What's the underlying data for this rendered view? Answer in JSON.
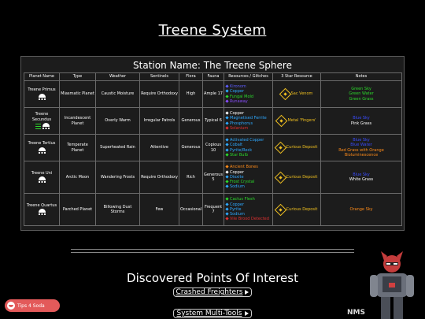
{
  "system_title": "Treene System",
  "station_title": "Station Name: The Treene Sphere",
  "columns": [
    "Planet Name",
    "Type",
    "Weather",
    "Sentinels",
    "Flora",
    "Fauna",
    "Resources / Glitches",
    "3 Star Resource",
    "Notes"
  ],
  "rows": [
    {
      "name": "Treene Primus",
      "type": "Miasmatic Planet",
      "weather": "Caustic Moisture",
      "sentinels": "Require Orthodoxy",
      "flora": "High",
      "fauna": "Ample 17",
      "resources": [
        {
          "t": "Kironom",
          "c": "#5e5eff"
        },
        {
          "t": "Copper",
          "c": "#2ea9ff"
        },
        {
          "t": "Fungal Mold",
          "c": "#2bd92b"
        },
        {
          "t": "Runaway",
          "c": "#8a4dff"
        }
      ],
      "star": "Sac Venom",
      "star_color": "#f0c020",
      "notes": [
        {
          "t": "Green Sky",
          "c": "#2bd92b"
        },
        {
          "t": "Green Water",
          "c": "#2bd92b"
        },
        {
          "t": "Green Grass",
          "c": "#2bd92b"
        }
      ]
    },
    {
      "name": "Treene Secundus",
      "type": "Incandescent Planet",
      "weather": "Overly Warm",
      "sentinels": "Irregular Patrols",
      "flora": "Generous",
      "fauna": "Typical 6",
      "resources": [
        {
          "t": "Copper",
          "c": "#ffffff"
        },
        {
          "t": "Magnetised Ferrite",
          "c": "#2ea9ff"
        },
        {
          "t": "Phosphorus",
          "c": "#2ea9ff"
        },
        {
          "t": "Solanium",
          "c": "#e03030"
        }
      ],
      "star": "Metal 'Fingers'",
      "star_color": "#f0c020",
      "notes": [
        {
          "t": "Blue Sky",
          "c": "#3a4cff"
        },
        {
          "t": "Pink Grass",
          "c": "#ffffff"
        }
      ]
    },
    {
      "name": "Treene Tertius",
      "type": "Temperate Planet",
      "weather": "Superheated Rain",
      "sentinels": "Attentive",
      "flora": "Generous",
      "fauna": "Copious 10",
      "resources": [
        {
          "t": "Activated Copper",
          "c": "#2ea9ff"
        },
        {
          "t": "Cobalt",
          "c": "#2ea9ff"
        },
        {
          "t": "Pyrite/Rock",
          "c": "#2ea9ff"
        },
        {
          "t": "Star Bulb",
          "c": "#2bd92b"
        }
      ],
      "star": "Curious Deposit",
      "star_color": "#f0c020",
      "notes": [
        {
          "t": "Blue Sky",
          "c": "#3a4cff"
        },
        {
          "t": "Blue Water",
          "c": "#3a4cff"
        },
        {
          "t": "Red Grass with Orange Bioluminescence",
          "c": "#ff8c1a"
        }
      ]
    },
    {
      "name": "Treene Uni",
      "type": "Arctic Moon",
      "weather": "Wandering Frosts",
      "sentinels": "Require Orthodoxy",
      "flora": "Rich",
      "fauna": "Generous 5",
      "resources": [
        {
          "t": "Ancient Bones",
          "c": "#ff8c1a"
        },
        {
          "t": "Copper",
          "c": "#ffffff"
        },
        {
          "t": "Dioxite",
          "c": "#2ea9ff"
        },
        {
          "t": "Frost Crystal",
          "c": "#2bd92b"
        },
        {
          "t": "Sodium",
          "c": "#2ea9ff"
        }
      ],
      "star": "Curious Deposit",
      "star_color": "#f0c020",
      "notes": [
        {
          "t": "Blue Sky",
          "c": "#3a4cff"
        },
        {
          "t": "White Grass",
          "c": "#ffffff"
        }
      ]
    },
    {
      "name": "Treene Quartus",
      "type": "Parched Planet",
      "weather": "Billowing Dust Storms",
      "sentinels": "Few",
      "flora": "Occasional",
      "fauna": "Frequent 7",
      "resources": [
        {
          "t": "Cactus Flesh",
          "c": "#2bd92b"
        },
        {
          "t": "Copper",
          "c": "#2ea9ff"
        },
        {
          "t": "Pyrite",
          "c": "#2ea9ff"
        },
        {
          "t": "Sodium",
          "c": "#2ea9ff"
        },
        {
          "t": "Vile Brood Detected",
          "c": "#e03030"
        }
      ],
      "star": "Curious Deposit",
      "star_color": "#f0c020",
      "notes": [
        {
          "t": "Orange Sky",
          "c": "#ff8c1a"
        }
      ]
    }
  ],
  "poi_title": "Discovered Points Of Interest",
  "links": [
    "Crashed Freighters",
    "System Multi-Tools"
  ],
  "tips_label": "Tips 4 Soda",
  "logo_text": "NMS"
}
